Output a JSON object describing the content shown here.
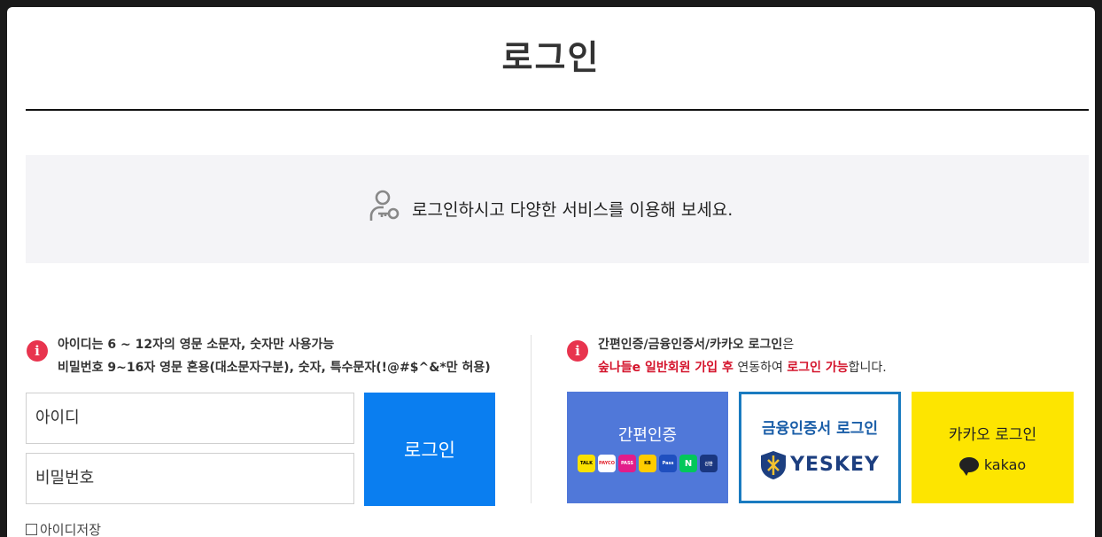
{
  "page": {
    "title": "로그인"
  },
  "banner": {
    "text": "로그인하시고 다양한 서비스를 이용해 보세요.",
    "icon": "user-key-icon"
  },
  "left_info": {
    "line1": "아이디는 6 ~ 12자의 영문 소문자, 숫자만 사용가능",
    "line2": "비밀번호 9~16자 영문 혼용(대소문자구분), 숫자, 특수문자(!@#$^&*만 허용)"
  },
  "form": {
    "id_placeholder": "아이디",
    "pw_placeholder": "비밀번호",
    "login_label": "로그인",
    "save_id_label": "아이디저장"
  },
  "right_info": {
    "line1": "간편인증/금융인증서/카카오 로그인",
    "line1_suffix": "은",
    "line2_red1": "숲나들e 일반회원 가입 후",
    "line2_mid": " 연동하여 ",
    "line2_red2": "로그인 가능",
    "line2_end": "합니다."
  },
  "cards": {
    "simple_label": "간편인증",
    "providers": [
      "TALK",
      "PAYCO",
      "PASS",
      "KB",
      "Pass",
      "N",
      "신한"
    ],
    "cert_label": "금융인증서 로그인",
    "cert_brand": "YESKEY",
    "kakao_label": "카카오 로그인",
    "kakao_brand": "kakao"
  },
  "colors": {
    "accent": "#0a7ef0",
    "alert": "#e8344e",
    "simple_bg": "#5078d9",
    "kakao_bg": "#fde500",
    "cert_border": "#1a7bc0"
  }
}
